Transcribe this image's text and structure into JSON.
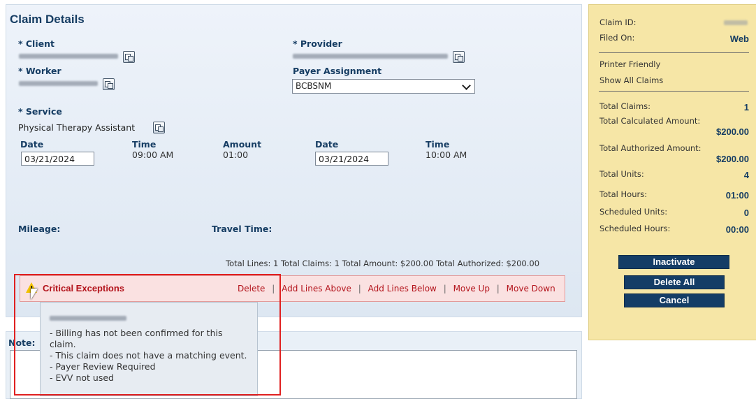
{
  "claim": {
    "title": "Claim Details",
    "client_label": "* Client",
    "provider_label": "* Provider",
    "worker_label": "* Worker",
    "payer_label": "Payer Assignment",
    "payer_value": "BCBSNM",
    "service_label": "* Service",
    "service_value": "Physical Therapy Assistant",
    "date_label": "Date",
    "time_label": "Time",
    "amount_label": "Amount",
    "start_date": "03/21/2024",
    "start_time": "09:00 AM",
    "amount_value": "01:00",
    "end_date": "03/21/2024",
    "end_time": "10:00 AM",
    "mileage_label": "Mileage:",
    "travel_label": "Travel Time:",
    "totals_line": "Total Lines: 1 Total Claims: 1 Total Amount: $200.00 Total Authorized: $200.00"
  },
  "exceptions": {
    "title": "Critical Exceptions",
    "actions": [
      "Delete",
      "Add Lines Above",
      "Add Lines Below",
      "Move Up",
      "Move Down"
    ],
    "separator": "|",
    "tooltip_lines": [
      "- Billing has not been confirmed for this",
      "claim.",
      "- This claim does not have a matching event.",
      "- Payer Review Required",
      "- EVV not used"
    ]
  },
  "note": {
    "label": "Note:"
  },
  "summary": {
    "claim_id_label": "Claim ID:",
    "filed_on_label": "Filed On:",
    "filed_on_value": "Web",
    "printer_friendly": "Printer Friendly",
    "show_all_claims": "Show All Claims",
    "total_claims_label": "Total Claims:",
    "total_claims_value": "1",
    "total_calc_label": "Total Calculated Amount:",
    "total_calc_value": "$200.00",
    "total_auth_label": "Total Authorized Amount:",
    "total_auth_value": "$200.00",
    "total_units_label": "Total Units:",
    "total_units_value": "4",
    "total_hours_label": "Total Hours:",
    "total_hours_value": "01:00",
    "sched_units_label": "Scheduled Units:",
    "sched_units_value": "0",
    "sched_hours_label": "Scheduled Hours:",
    "sched_hours_value": "00:00"
  },
  "buttons": {
    "inactivate": "Inactivate",
    "delete_all": "Delete All",
    "cancel": "Cancel"
  },
  "colors": {
    "panel_blue": "#dde7f2",
    "label_blue": "#163d63",
    "summary_yellow": "#f6e6a6",
    "button_navy": "#143d66",
    "alert_red": "#b3131b"
  },
  "icons": [
    "copy-icon",
    "warning-icon",
    "chevron-down-icon",
    "mouse-cursor-icon"
  ]
}
